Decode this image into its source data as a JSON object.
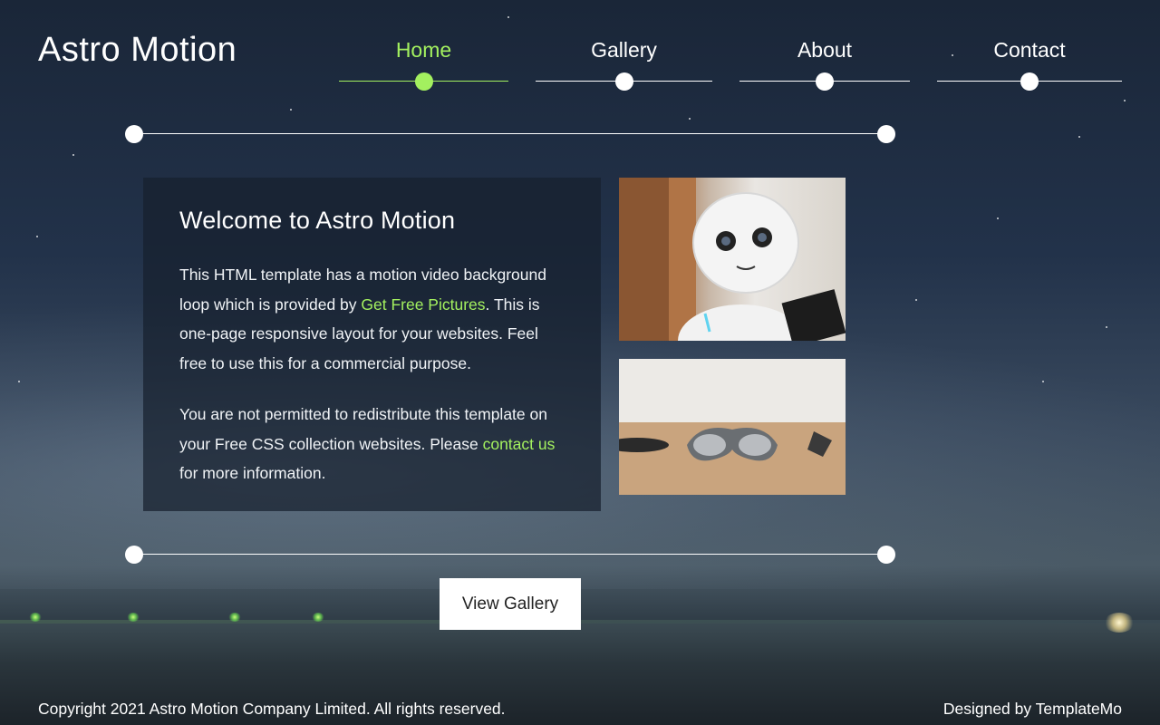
{
  "brand": {
    "name": "Astro Motion"
  },
  "nav": {
    "items": [
      {
        "label": "Home",
        "active": true
      },
      {
        "label": "Gallery",
        "active": false
      },
      {
        "label": "About",
        "active": false
      },
      {
        "label": "Contact",
        "active": false
      }
    ]
  },
  "welcome": {
    "title": "Welcome to Astro Motion",
    "p1_before": "This HTML template has a motion video background loop which is provided by ",
    "p1_link": "Get Free Pictures",
    "p1_after": ". This is one-page responsive layout for your websites. Feel free to use this for a commercial purpose.",
    "p2_before": "You are not permitted to redistribute this template on your Free CSS collection websites. Please ",
    "p2_link": "contact us",
    "p2_after": " for more information."
  },
  "images": [
    {
      "icon": "robot-photo"
    },
    {
      "icon": "vr-glasses-photo"
    }
  ],
  "cta": {
    "label": "View Gallery"
  },
  "footer": {
    "copyright": "Copyright 2021 Astro Motion Company Limited. All rights reserved.",
    "credit": "Designed by TemplateMo"
  },
  "colors": {
    "accent": "#a3f05f",
    "panel_bg": "rgba(22, 32, 46, 0.72)",
    "text": "#ffffff"
  }
}
